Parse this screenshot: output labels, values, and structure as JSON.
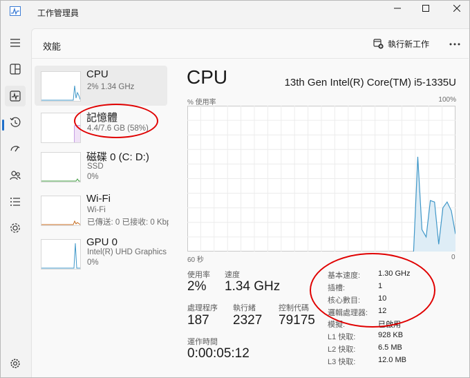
{
  "window": {
    "title": "工作管理員"
  },
  "header": {
    "page_title": "效能",
    "run_new_task": "執行新工作"
  },
  "colors": {
    "accent": "#1e6fc9",
    "cpu_line": "#3f97c8",
    "memory_line": "#8c3fc8",
    "disk_line": "#3c9a3c",
    "wifi_line": "#c46a1e",
    "annotation": "#e00000"
  },
  "sidebar": {
    "icons": [
      "hamburger-icon",
      "processes-icon",
      "performance-icon",
      "app-history-icon",
      "startup-apps-icon",
      "users-icon",
      "details-icon",
      "services-icon",
      "settings-icon"
    ]
  },
  "perf_items": [
    {
      "name": "CPU",
      "sub1": "2%  1.34 GHz"
    },
    {
      "name": "記憶體",
      "sub1": "4.4/7.6 GB (58%)"
    },
    {
      "name": "磁碟 0 (C: D:)",
      "sub1": "SSD",
      "sub2": "0%"
    },
    {
      "name": "Wi-Fi",
      "sub1": "Wi-Fi",
      "sub2": "已傳送: 0 已接收: 0 Kbp"
    },
    {
      "name": "GPU 0",
      "sub1": "Intel(R) UHD Graphics",
      "sub2": "0%"
    }
  ],
  "detail": {
    "title": "CPU",
    "model": "13th Gen Intel(R) Core(TM) i5-1335U",
    "usage_label": "% 使用率",
    "max_label": "100%",
    "time_label": "60 秒",
    "min_label": "0",
    "stats": {
      "utilization_label": "使用率",
      "utilization": "2%",
      "speed_label": "速度",
      "speed": "1.34 GHz",
      "processes_label": "處理程序",
      "processes": "187",
      "threads_label": "執行緒",
      "threads": "2327",
      "handles_label": "控制代碼",
      "handles": "79175",
      "uptime_label": "運作時間",
      "uptime": "0:00:05:12"
    },
    "specs": [
      {
        "k": "基本速度:",
        "v": "1.30 GHz"
      },
      {
        "k": "插槽:",
        "v": "1"
      },
      {
        "k": "核心數目:",
        "v": "10"
      },
      {
        "k": "邏輯處理器:",
        "v": "12"
      },
      {
        "k": "模擬:",
        "v": "已啟用"
      },
      {
        "k": "L1 快取:",
        "v": "928 KB"
      },
      {
        "k": "L2 快取:",
        "v": "6.5 MB"
      },
      {
        "k": "L3 快取:",
        "v": "12.0 MB"
      }
    ]
  },
  "cpu_history": [
    0,
    0,
    0,
    0,
    0,
    0,
    0,
    0,
    0,
    0,
    0,
    0,
    0,
    0,
    0,
    0,
    0,
    0,
    0,
    0,
    0,
    0,
    0,
    0,
    0,
    0,
    0,
    0,
    0,
    0,
    0,
    0,
    0,
    0,
    0,
    0,
    0,
    0,
    0,
    0,
    0,
    0,
    0,
    0,
    0,
    0,
    0,
    0,
    0,
    0,
    0,
    0,
    0,
    0,
    0,
    65,
    15,
    10,
    35,
    34,
    5,
    30,
    34,
    28,
    12
  ]
}
